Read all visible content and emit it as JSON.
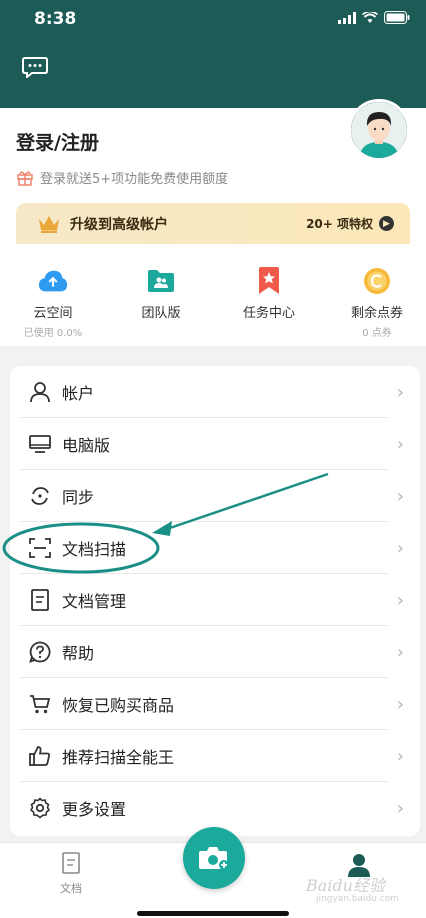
{
  "status_bar": {
    "time": "8:38"
  },
  "header": {
    "message_icon": "chat-bubble-icon"
  },
  "profile": {
    "login_title": "登录/注册",
    "promo_text": "登录就送5+项功能免费使用额度",
    "promo_icon": "gift-icon"
  },
  "upgrade": {
    "title": "升级到高级帐户",
    "badge": "20+ 项特权",
    "icon": "crown-icon"
  },
  "quick_access": [
    {
      "label": "云空间",
      "sub": "已使用 0.0%",
      "icon": "cloud-upload-icon",
      "color": "#2f9bf0"
    },
    {
      "label": "团队版",
      "sub": "",
      "icon": "team-folder-icon",
      "color": "#1aa99a"
    },
    {
      "label": "任务中心",
      "sub": "",
      "icon": "bookmark-star-icon",
      "color": "#f15a4a"
    },
    {
      "label": "剩余点券",
      "sub": "0 点券",
      "icon": "coin-icon",
      "color": "#f6b93b"
    }
  ],
  "menu": [
    {
      "label": "帐户",
      "icon": "person-icon"
    },
    {
      "label": "电脑版",
      "icon": "desktop-icon"
    },
    {
      "label": "同步",
      "icon": "sync-icon"
    },
    {
      "label": "文档扫描",
      "icon": "scan-icon"
    },
    {
      "label": "文档管理",
      "icon": "document-icon"
    },
    {
      "label": "帮助",
      "icon": "help-icon"
    },
    {
      "label": "恢复已购买商品",
      "icon": "cart-icon"
    },
    {
      "label": "推荐扫描全能王",
      "icon": "thumbs-up-icon"
    },
    {
      "label": "更多设置",
      "icon": "settings-icon"
    }
  ],
  "bottom_nav": {
    "doc_label": "文档",
    "camera_icon": "camera-plus-icon",
    "me_icon": "user-icon"
  },
  "watermark": {
    "text": "Baidu经验",
    "sub": "jingyan.baidu.com"
  },
  "colors": {
    "header": "#1d5b57",
    "accent": "#1aa99a",
    "annotation": "#1a8f86"
  }
}
